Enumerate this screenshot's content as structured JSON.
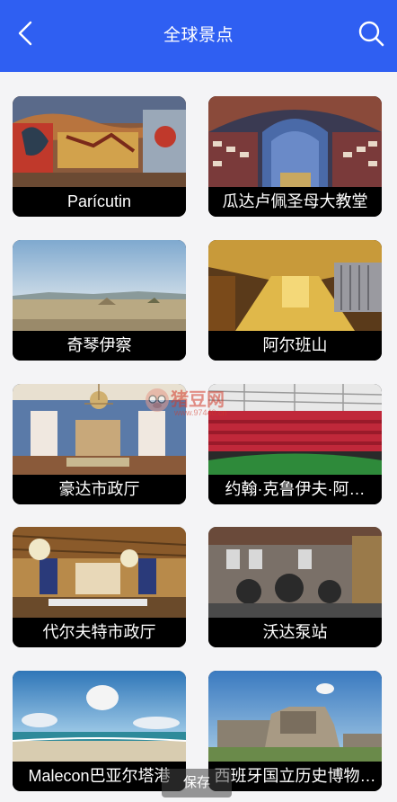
{
  "header": {
    "title": "全球景点",
    "back_icon": "back-chevron-icon",
    "search_icon": "search-icon",
    "accent_color": "#2f5ff2"
  },
  "places": [
    {
      "name": "Parícutin"
    },
    {
      "name": "瓜达卢佩圣母大教堂"
    },
    {
      "name": "奇琴伊察"
    },
    {
      "name": "阿尔班山"
    },
    {
      "name": "豪达市政厅"
    },
    {
      "name": "约翰·克鲁伊夫·阿…"
    },
    {
      "name": "代尔夫特市政厅"
    },
    {
      "name": "沃达泵站"
    },
    {
      "name": "Malecon巴亚尔塔港"
    },
    {
      "name": "西班牙国立历史博物…"
    }
  ],
  "watermark": {
    "brand": "猪豆网",
    "url": "www.97440.cn"
  },
  "toast": {
    "label": "保存"
  }
}
